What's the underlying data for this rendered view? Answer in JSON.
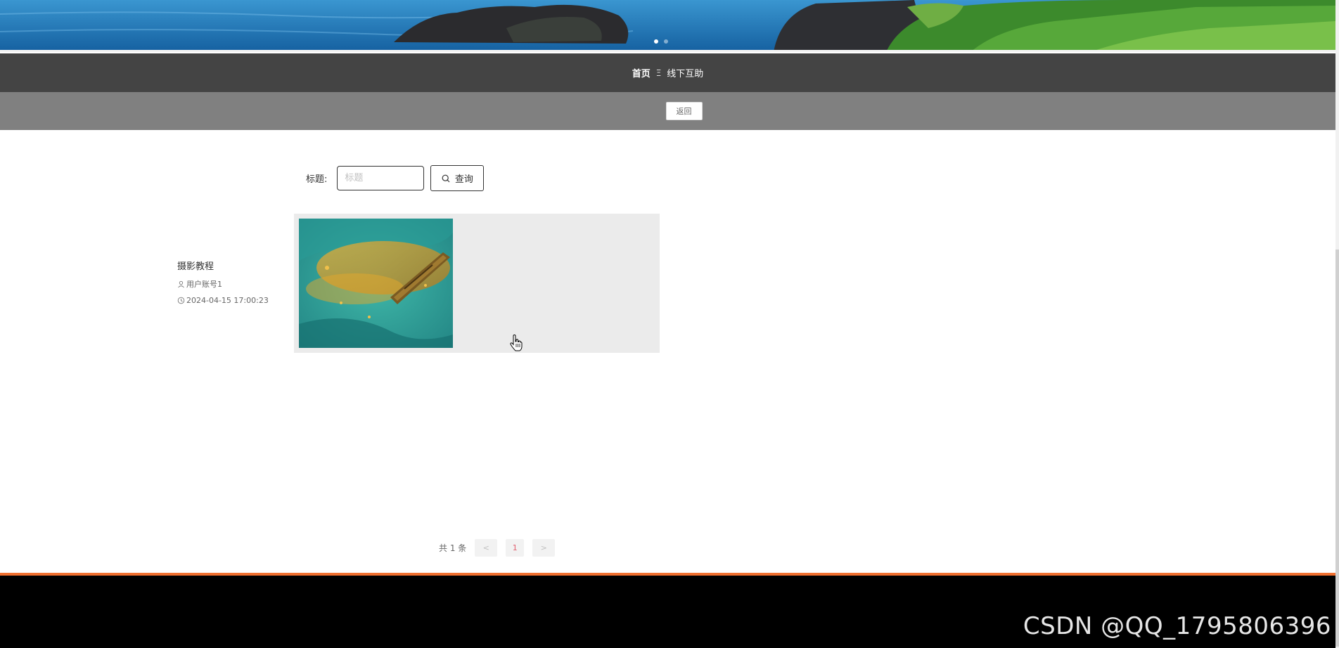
{
  "breadcrumb": {
    "home": "首页",
    "separator": "Ξ",
    "current": "线下互助"
  },
  "back_button": {
    "label": "返回"
  },
  "search": {
    "label": "标题:",
    "placeholder": "标题",
    "value": "",
    "button_label": "查询",
    "icon": "search-icon"
  },
  "posts": [
    {
      "title": "摄影教程",
      "author": "用户账号1",
      "time": "2024-04-15 17:00:23",
      "author_icon": "user-icon",
      "time_icon": "clock-icon"
    }
  ],
  "pagination": {
    "total_text": "共 1 条",
    "prev": "<",
    "current_page": "1",
    "next": ">"
  },
  "banner": {
    "active_slide": 1,
    "slides": 2
  },
  "colors": {
    "nav_bg": "#444444",
    "back_bar_bg": "#808080",
    "footer_accent": "#f07030",
    "footer_bg": "#000000",
    "card_bg": "#ebebeb",
    "active_page": "#e06070"
  },
  "watermark": "CSDN @QQ_1795806396"
}
